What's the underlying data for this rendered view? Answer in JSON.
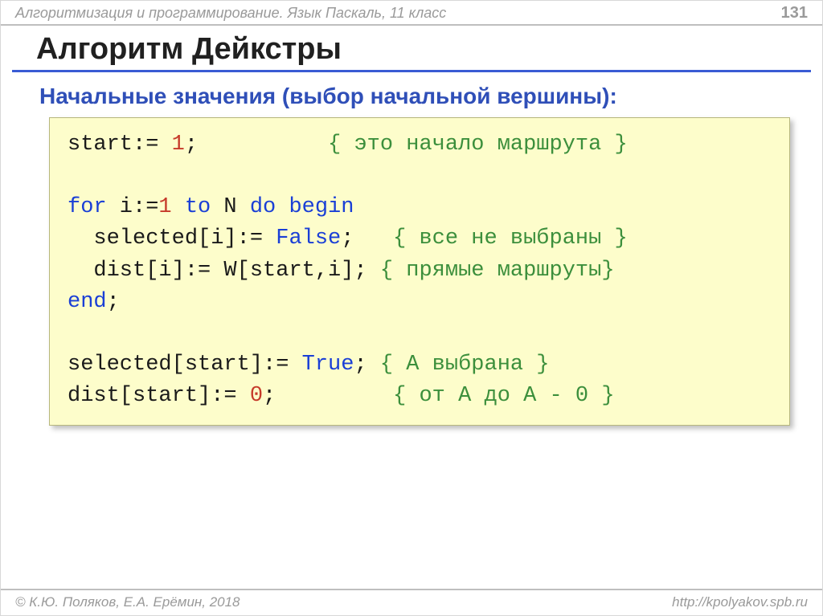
{
  "header": {
    "breadcrumb": "Алгоритмизация и программирование. Язык Паскаль, 11 класс",
    "page_number": "131"
  },
  "title": "Алгоритм Дейкстры",
  "subtitle": "Начальные значения (выбор начальной вершины):",
  "code": {
    "line1_a": "start:= ",
    "line1_num": "1",
    "line1_b": ";          ",
    "line1_cmt": "{ это начало маршрута }",
    "line2_kw1": "for",
    "line2_a": " i:=",
    "line2_num": "1",
    "line2_b": " ",
    "line2_kw2": "to",
    "line2_c": " N ",
    "line2_kw3": "do begin",
    "line3_a": "  selected[i]:= ",
    "line3_kw": "False",
    "line3_b": ";   ",
    "line3_cmt": "{ все не выбраны }",
    "line4_a": "  dist[i]:= W[start,i]; ",
    "line4_cmt": "{ прямые маршруты}",
    "line5_kw": "end",
    "line5_b": ";",
    "line6_a": "selected[start]:= ",
    "line6_kw": "True",
    "line6_b": "; ",
    "line6_cmt": "{ A выбрана }",
    "line7_a": "dist[start]:= ",
    "line7_num": "0",
    "line7_b": ";         ",
    "line7_cmt": "{ от A до A - 0 }"
  },
  "footer": {
    "copyright": "© К.Ю. Поляков, Е.А. Ерёмин, 2018",
    "url": "http://kpolyakov.spb.ru"
  }
}
